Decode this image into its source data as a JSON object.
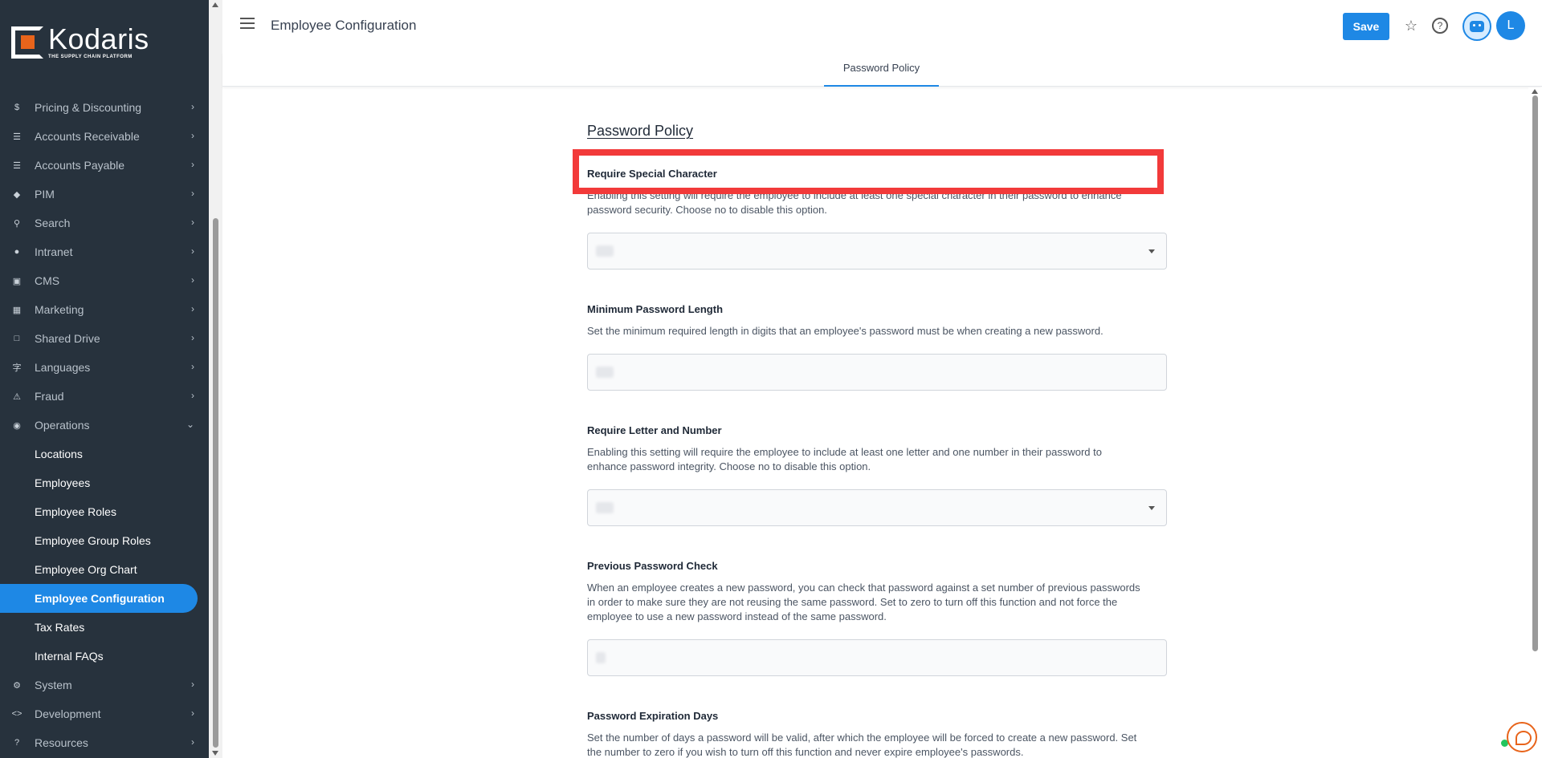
{
  "brand": {
    "name": "Kodaris",
    "tagline": "THE SUPPLY CHAIN PLATFORM"
  },
  "colors": {
    "sidebar_bg": "#27323d",
    "accent": "#1e88e5",
    "brand_orange": "#e8641b",
    "highlight": "#f23a3a"
  },
  "sidebar": {
    "items": [
      {
        "label": "Pricing & Discounting",
        "icon": "dollar-icon"
      },
      {
        "label": "Accounts Receivable",
        "icon": "bank-icon"
      },
      {
        "label": "Accounts Payable",
        "icon": "bank-icon"
      },
      {
        "label": "PIM",
        "icon": "tag-icon"
      },
      {
        "label": "Search",
        "icon": "search-icon"
      },
      {
        "label": "Intranet",
        "icon": "globe-icon"
      },
      {
        "label": "CMS",
        "icon": "web-icon"
      },
      {
        "label": "Marketing",
        "icon": "contact-card-icon"
      },
      {
        "label": "Shared Drive",
        "icon": "folder-icon"
      },
      {
        "label": "Languages",
        "icon": "translate-icon"
      },
      {
        "label": "Fraud",
        "icon": "alert-icon"
      },
      {
        "label": "Operations",
        "icon": "palette-icon"
      }
    ],
    "operations_sub": [
      {
        "label": "Locations"
      },
      {
        "label": "Employees"
      },
      {
        "label": "Employee Roles"
      },
      {
        "label": "Employee Group Roles"
      },
      {
        "label": "Employee Org Chart"
      },
      {
        "label": "Employee Configuration",
        "active": true
      },
      {
        "label": "Tax Rates"
      },
      {
        "label": "Internal FAQs"
      }
    ],
    "bottom_items": [
      {
        "label": "System",
        "icon": "gear-icon"
      },
      {
        "label": "Development",
        "icon": "code-icon"
      },
      {
        "label": "Resources",
        "icon": "help-icon"
      }
    ]
  },
  "header": {
    "title": "Employee Configuration",
    "save_label": "Save",
    "avatar_initial": "L"
  },
  "tabs": [
    {
      "label": "Password Policy",
      "active": true
    }
  ],
  "section": {
    "title": "Password Policy",
    "fields": [
      {
        "label": "Require Special Character",
        "description": "Enabling this setting will require the employee to include at least one special character in their password to enhance password security. Choose no to disable this option.",
        "type": "select"
      },
      {
        "label": "Minimum Password Length",
        "description": "Set the minimum required length in digits that an employee's password must be when creating a new password.",
        "type": "input"
      },
      {
        "label": "Require Letter and Number",
        "description": "Enabling this setting will require the employee to include at least one letter and one number in their password to enhance password integrity. Choose no to disable this option.",
        "type": "select"
      },
      {
        "label": "Previous Password Check",
        "description": "When an employee creates a new password, you can check that password against a set number of previous passwords in order to make sure they are not reusing the same password. Set to zero to turn off this function and not force the employee to use a new password instead of the same password.",
        "type": "input"
      },
      {
        "label": "Password Expiration Days",
        "description": "Set the number of days a password will be valid, after which the employee will be forced to create a new password. Set the number to zero if you wish to turn off this function and never expire employee's passwords.",
        "type": "input"
      }
    ]
  }
}
